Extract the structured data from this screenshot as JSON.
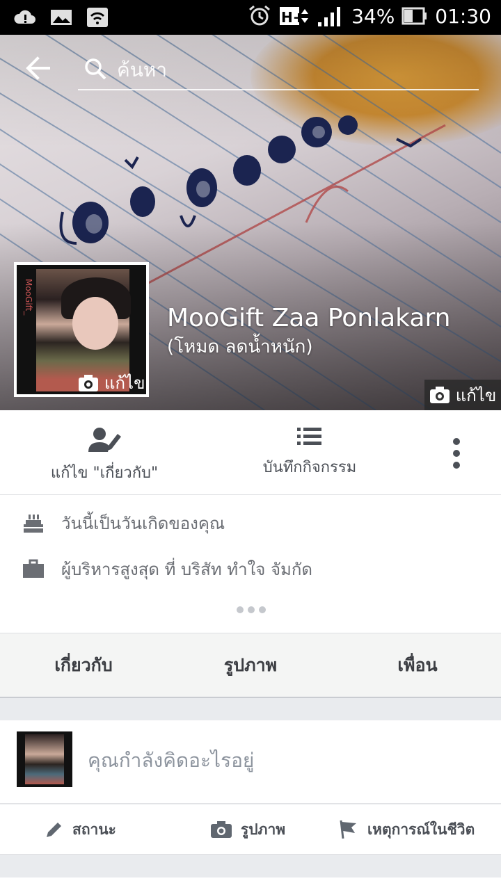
{
  "status_bar": {
    "battery": "34%",
    "time": "01:30",
    "network": "H+",
    "icons": [
      "cloud-alert-icon",
      "image-icon",
      "wifi-icon",
      "alarm-icon",
      "signal-icon",
      "battery-icon"
    ]
  },
  "search": {
    "placeholder": "ค้นหา"
  },
  "profile": {
    "name": "MooGift Zaa Ponlakarn",
    "nickname": "(โหมด ลดน้ำหนัก)",
    "avatar_edit_label": "แก้ไข",
    "cover_edit_label": "แก้ไข",
    "avatar_watermark": "MooGift_"
  },
  "actions": {
    "edit_about": "แก้ไข \"เกี่ยวกับ\"",
    "activity_log": "บันทึกกิจกรรม"
  },
  "intro": {
    "birthday": "วันนี้เป็นวันเกิดของคุณ",
    "work": "ผู้บริหารสูงสุด ที่ บริสัท ทำใจ จัมกัด"
  },
  "tabs": {
    "about": "เกี่ยวกับ",
    "photos": "รูปภาพ",
    "friends": "เพื่อน"
  },
  "composer": {
    "placeholder": "คุณกำลังคิดอะไรอยู่",
    "status": "สถานะ",
    "photo": "รูปภาพ",
    "life_event": "เหตุการณ์ในชีวิต"
  },
  "colors": {
    "status_bar": "#000000",
    "text_primary": "#3b3d42",
    "text_secondary": "#6b6e74",
    "divider": "#dddfe2",
    "page_bg": "#e9ebee"
  }
}
